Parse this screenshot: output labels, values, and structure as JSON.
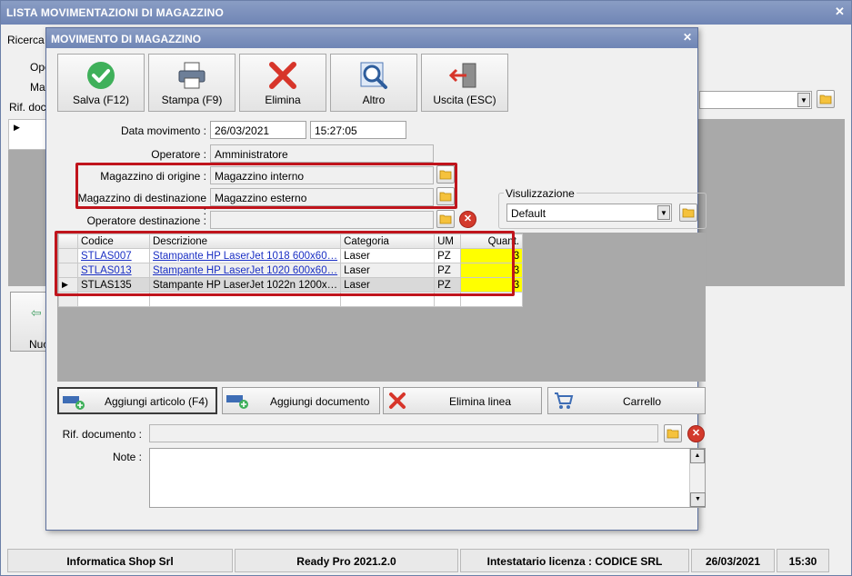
{
  "outer": {
    "title": "LISTA MOVIMENTAZIONI DI MAGAZZINO",
    "ricerca_label": "Ricerca (",
    "ope_label": "Ope",
    "mag_label": "Mag",
    "rif_label": "Rif. docu",
    "nuovo_label": "Nuo"
  },
  "modal": {
    "title": "MOVIMENTO DI MAGAZZINO",
    "toolbar": {
      "save": "Salva (F12)",
      "print": "Stampa (F9)",
      "delete": "Elimina",
      "other": "Altro",
      "exit": "Uscita (ESC)"
    },
    "form": {
      "date_label": "Data movimento :",
      "date_value": "26/03/2021",
      "time_value": "15:27:05",
      "operator_label": "Operatore :",
      "operator_value": "Amministratore",
      "origin_label": "Magazzino di origine :",
      "origin_value": "Magazzino interno",
      "dest_label": "Magazzino di destinazione :",
      "dest_value": "Magazzino esterno",
      "dest_operator_label": "Operatore destinazione :",
      "dest_operator_value": ""
    },
    "view": {
      "label": "Visulizzazione",
      "value": "Default"
    },
    "grid": {
      "columns": [
        "Codice",
        "Descrizione",
        "Categoria",
        "UM",
        "Quant."
      ],
      "rows": [
        {
          "code": "STLAS007",
          "desc": "Stampante HP LaserJet 1018 600x60…",
          "cat": "Laser",
          "um": "PZ",
          "qty": "3"
        },
        {
          "code": "STLAS013",
          "desc": "Stampante HP LaserJet 1020 600x60…",
          "cat": "Laser",
          "um": "PZ",
          "qty": "3"
        },
        {
          "code": "STLAS135",
          "desc": "Stampante HP LaserJet 1022n 1200x…",
          "cat": "Laser",
          "um": "PZ",
          "qty": "3"
        }
      ]
    },
    "actions": {
      "add_article": "Aggiungi articolo (F4)",
      "add_document": "Aggiungi documento",
      "delete_line": "Elimina linea",
      "cart": "Carrello"
    },
    "rif_label": "Rif. documento :",
    "note_label": "Note :"
  },
  "statusbar": {
    "company": "Informatica Shop Srl",
    "version": "Ready Pro 2021.2.0",
    "license": "Intestatario licenza : CODICE SRL",
    "date": "26/03/2021",
    "time": "15:30"
  },
  "colors": {
    "titlebar": "#7a8fbd",
    "highlight_box": "#c0141c",
    "qty_bg": "#ffff00",
    "link": "#1a2fc4"
  }
}
